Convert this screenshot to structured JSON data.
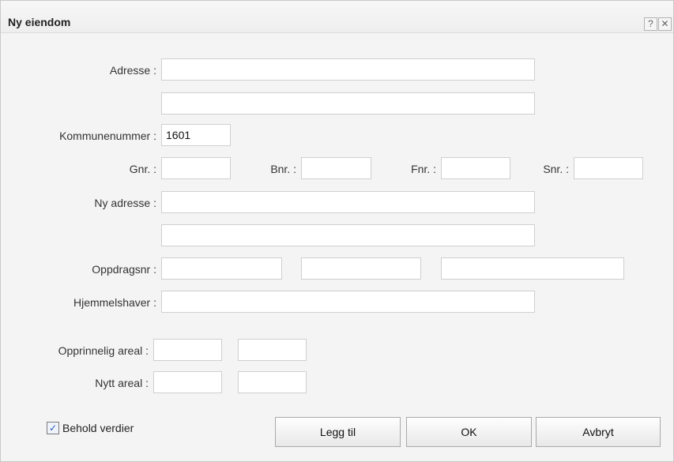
{
  "dialog": {
    "title": "Ny eiendom",
    "help_glyph": "?",
    "close_glyph": "✕"
  },
  "form": {
    "adresse_label": "Adresse :",
    "adresse_line1": "",
    "adresse_line2": "",
    "kommunenummer_label": "Kommunenummer :",
    "kommunenummer_value": "1601",
    "gnr_label": "Gnr. :",
    "gnr_value": "",
    "bnr_label": "Bnr. :",
    "bnr_value": "",
    "fnr_label": "Fnr. :",
    "fnr_value": "",
    "snr_label": "Snr. :",
    "snr_value": "",
    "ny_adresse_label": "Ny adresse :",
    "ny_adresse_line1": "",
    "ny_adresse_line2": "",
    "oppdragsnr_label": "Oppdragsnr :",
    "oppdragsnr_1": "",
    "oppdragsnr_2": "",
    "oppdragsnr_3": "",
    "hjemmelshaver_label": "Hjemmelshaver :",
    "hjemmelshaver_value": "",
    "opprinnelig_areal_label": "Opprinnelig areal :",
    "opprinnelig_areal_1": "",
    "opprinnelig_areal_2": "",
    "nytt_areal_label": "Nytt areal :",
    "nytt_areal_1": "",
    "nytt_areal_2": ""
  },
  "footer": {
    "behold_verdier_label": "Behold verdier",
    "behold_verdier_checked": true,
    "check_glyph": "✓",
    "legg_til_label": "Legg til",
    "ok_label": "OK",
    "avbryt_label": "Avbryt"
  }
}
